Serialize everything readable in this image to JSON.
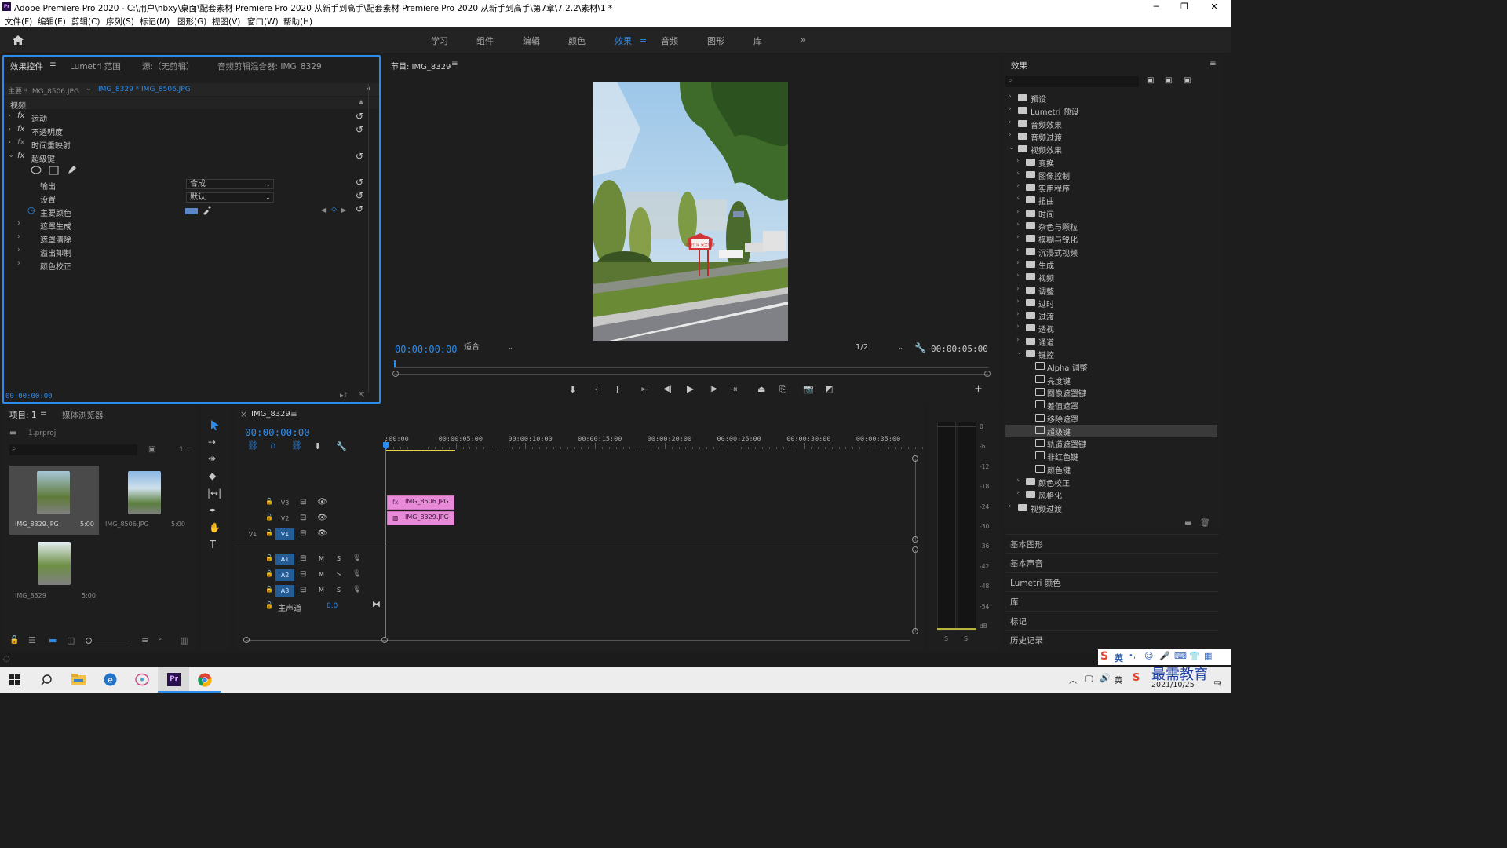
{
  "window": {
    "title": "Adobe Premiere Pro 2020 - C:\\用户\\hbxy\\桌面\\配套素材 Premiere Pro 2020 从新手到高手\\配套素材 Premiere Pro 2020 从新手到高手\\第7章\\7.2.2\\素材\\1 *",
    "minimize": "─",
    "maximize": "❐",
    "close": "✕"
  },
  "menu": [
    "文件(F)",
    "编辑(E)",
    "剪辑(C)",
    "序列(S)",
    "标记(M)",
    "图形(G)",
    "视图(V)",
    "窗口(W)",
    "帮助(H)"
  ],
  "workspaces": {
    "items": [
      "学习",
      "组件",
      "编辑",
      "颜色",
      "效果",
      "音频",
      "图形",
      "库"
    ],
    "active": "效果",
    "more": "»"
  },
  "effect_controls": {
    "tabs": [
      "效果控件",
      "Lumetri 范围",
      "源:（无剪辑）",
      "音频剪辑混合器: IMG_8329"
    ],
    "menu_icon": "≡",
    "master_clip": "主要 * IMG_8506.JPG",
    "sequence_clip": "IMG_8329 * IMG_8506.JPG",
    "section_video": "视频",
    "effects": [
      {
        "fx": "fx",
        "name": "运动"
      },
      {
        "fx": "fx",
        "name": "不透明度"
      },
      {
        "fx": "fx",
        "name": "时间重映射"
      },
      {
        "fx": "fx",
        "name": "超级键"
      }
    ],
    "props": {
      "output_label": "输出",
      "output_value": "合成",
      "setting_label": "设置",
      "setting_value": "默认",
      "key_color_label": "主要颜色",
      "key_color": "#5b86c8"
    },
    "groups": [
      "遮罩生成",
      "遮罩清除",
      "溢出抑制",
      "颜色校正"
    ],
    "timecode": "00:00:00:00"
  },
  "program": {
    "title": "节目: IMG_8329",
    "menu_icon": "≡",
    "timecode": "00:00:00:00",
    "fit": "适合",
    "resolution": "1/2",
    "duration": "00:00:05:00",
    "sign_text": "文明行车 安全驾驶"
  },
  "effects_panel": {
    "title": "效果",
    "menu_icon": "≡",
    "search_placeholder": "",
    "tree": [
      {
        "level": 0,
        "name": "预设",
        "type": "folder-star",
        "open": false
      },
      {
        "level": 0,
        "name": "Lumetri 预设",
        "type": "folder-star",
        "open": false
      },
      {
        "level": 0,
        "name": "音频效果",
        "type": "folder",
        "open": false
      },
      {
        "level": 0,
        "name": "音频过渡",
        "type": "folder",
        "open": false
      },
      {
        "level": 0,
        "name": "视频效果",
        "type": "folder",
        "open": true
      },
      {
        "level": 1,
        "name": "变换",
        "type": "folder",
        "open": false
      },
      {
        "level": 1,
        "name": "图像控制",
        "type": "folder",
        "open": false
      },
      {
        "level": 1,
        "name": "实用程序",
        "type": "folder",
        "open": false
      },
      {
        "level": 1,
        "name": "扭曲",
        "type": "folder",
        "open": false
      },
      {
        "level": 1,
        "name": "时间",
        "type": "folder",
        "open": false
      },
      {
        "level": 1,
        "name": "杂色与颗粒",
        "type": "folder",
        "open": false
      },
      {
        "level": 1,
        "name": "模糊与锐化",
        "type": "folder",
        "open": false
      },
      {
        "level": 1,
        "name": "沉浸式视频",
        "type": "folder",
        "open": false
      },
      {
        "level": 1,
        "name": "生成",
        "type": "folder",
        "open": false
      },
      {
        "level": 1,
        "name": "视频",
        "type": "folder",
        "open": false
      },
      {
        "level": 1,
        "name": "调整",
        "type": "folder",
        "open": false
      },
      {
        "level": 1,
        "name": "过时",
        "type": "folder",
        "open": false
      },
      {
        "level": 1,
        "name": "过渡",
        "type": "folder",
        "open": false
      },
      {
        "level": 1,
        "name": "透视",
        "type": "folder",
        "open": false
      },
      {
        "level": 1,
        "name": "通道",
        "type": "folder",
        "open": false
      },
      {
        "level": 1,
        "name": "键控",
        "type": "folder",
        "open": true
      },
      {
        "level": 2,
        "name": "Alpha 调整",
        "type": "preset"
      },
      {
        "level": 2,
        "name": "亮度键",
        "type": "preset"
      },
      {
        "level": 2,
        "name": "图像遮罩键",
        "type": "preset"
      },
      {
        "level": 2,
        "name": "差值遮罩",
        "type": "preset"
      },
      {
        "level": 2,
        "name": "移除遮罩",
        "type": "preset"
      },
      {
        "level": 2,
        "name": "超级键",
        "type": "preset",
        "selected": true
      },
      {
        "level": 2,
        "name": "轨道遮罩键",
        "type": "preset"
      },
      {
        "level": 2,
        "name": "非红色键",
        "type": "preset"
      },
      {
        "level": 2,
        "name": "颜色键",
        "type": "preset"
      },
      {
        "level": 1,
        "name": "颜色校正",
        "type": "folder",
        "open": false
      },
      {
        "level": 1,
        "name": "风格化",
        "type": "folder",
        "open": false
      },
      {
        "level": 0,
        "name": "视频过渡",
        "type": "folder",
        "open": false
      }
    ],
    "side_panels": [
      "基本图形",
      "基本声音",
      "Lumetri 颜色",
      "库",
      "标记",
      "历史记录"
    ]
  },
  "project": {
    "tabs": [
      "项目: 1",
      "媒体浏览器"
    ],
    "menu_icon": "≡",
    "file": "1.prproj",
    "count": "1...",
    "items": [
      {
        "name": "IMG_8329.JPG",
        "duration": "5:00"
      },
      {
        "name": "IMG_8506.JPG",
        "duration": "5:00"
      },
      {
        "name": "IMG_8329",
        "duration": "5:00"
      }
    ]
  },
  "timeline": {
    "close": "×",
    "title": "IMG_8329",
    "menu_icon": "≡",
    "timecode": "00:00:00:00",
    "ruler": [
      ":00:00",
      "00:00:05:00",
      "00:00:10:00",
      "00:00:15:00",
      "00:00:20:00",
      "00:00:25:00",
      "00:00:30:00",
      "00:00:35:00"
    ],
    "video_tracks": [
      "V3",
      "V2",
      "V1"
    ],
    "audio_tracks": [
      "A1",
      "A2",
      "A3"
    ],
    "source_v1": "V1",
    "mute": "M",
    "solo": "S",
    "master_label": "主声道",
    "master_value": "0.0",
    "clips": [
      {
        "track": "V3",
        "name": "IMG_8506.JPG"
      },
      {
        "track": "V2",
        "name": "IMG_8329.JPG"
      }
    ]
  },
  "audio_meter": {
    "scale": [
      "0",
      "-6",
      "-12",
      "-18",
      "-24",
      "-30",
      "-36",
      "-42",
      "-48",
      "-54",
      "dB"
    ],
    "solo_buttons": [
      "S",
      "S"
    ]
  },
  "tools": [
    "selection-tool",
    "track-select-tool",
    "ripple-edit-tool",
    "razor-tool",
    "slip-tool",
    "pen-tool",
    "hand-tool",
    "type-tool"
  ],
  "taskbar": {
    "apps": [
      "start-icon",
      "search-icon",
      "file-explorer-icon",
      "edge-icon",
      "app-icon",
      "premiere-icon",
      "chrome-icon"
    ],
    "ime": "英",
    "watermark": "最需教育",
    "date": "2021/10/25",
    "notification_count": "4"
  }
}
